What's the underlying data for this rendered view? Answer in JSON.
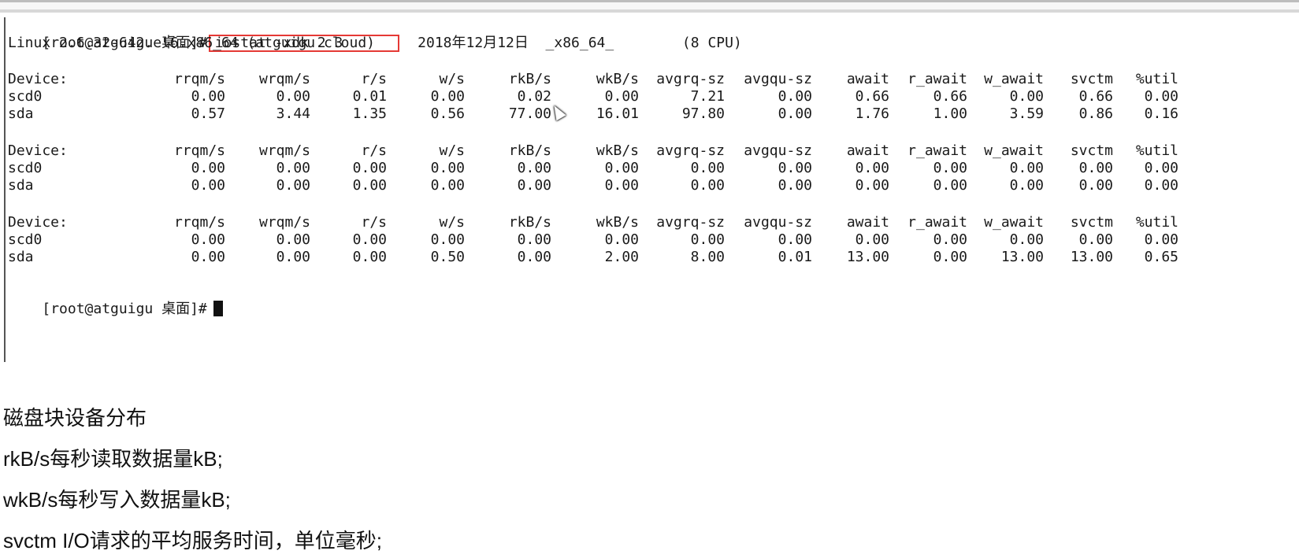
{
  "terminal": {
    "prompt": "[root@atguigu 桌面]#",
    "command": "iostat -xdk 2 3",
    "sysinfo": "Linux 2.6.32-642.el6.x86_64 (atguigu.cloud)     2018年12月12日  _x86_64_        (8 CPU)",
    "columns": [
      "Device:",
      "rrqm/s",
      "wrqm/s",
      "r/s",
      "w/s",
      "rkB/s",
      "wkB/s",
      "avgrq-sz",
      "avgqu-sz",
      "await",
      "r_await",
      "w_await",
      "svctm",
      "%util"
    ],
    "reports": [
      {
        "rows": [
          [
            "scd0",
            "0.00",
            "0.00",
            "0.01",
            "0.00",
            "0.02",
            "0.00",
            "7.21",
            "0.00",
            "0.66",
            "0.66",
            "0.00",
            "0.66",
            "0.00"
          ],
          [
            "sda",
            "0.57",
            "3.44",
            "1.35",
            "0.56",
            "77.00",
            "16.01",
            "97.80",
            "0.00",
            "1.76",
            "1.00",
            "3.59",
            "0.86",
            "0.16"
          ]
        ]
      },
      {
        "rows": [
          [
            "scd0",
            "0.00",
            "0.00",
            "0.00",
            "0.00",
            "0.00",
            "0.00",
            "0.00",
            "0.00",
            "0.00",
            "0.00",
            "0.00",
            "0.00",
            "0.00"
          ],
          [
            "sda",
            "0.00",
            "0.00",
            "0.00",
            "0.00",
            "0.00",
            "0.00",
            "0.00",
            "0.00",
            "0.00",
            "0.00",
            "0.00",
            "0.00",
            "0.00"
          ]
        ]
      },
      {
        "rows": [
          [
            "scd0",
            "0.00",
            "0.00",
            "0.00",
            "0.00",
            "0.00",
            "0.00",
            "0.00",
            "0.00",
            "0.00",
            "0.00",
            "0.00",
            "0.00",
            "0.00"
          ],
          [
            "sda",
            "0.00",
            "0.00",
            "0.00",
            "0.50",
            "0.00",
            "2.00",
            "8.00",
            "0.01",
            "13.00",
            "0.00",
            "13.00",
            "13.00",
            "0.65"
          ]
        ]
      }
    ],
    "final_prompt": "[root@atguigu 桌面]#"
  },
  "notes": {
    "line1": "磁盘块设备分布",
    "line2": "rkB/s每秒读取数据量kB;",
    "line3": "wkB/s每秒写入数据量kB;",
    "line4": "svctm I/O请求的平均服务时间，单位毫秒;"
  },
  "icons": {
    "cursor": "text-cursor-icon",
    "pointer": "mouse-pointer-icon"
  },
  "colors": {
    "highlight_border": "#e53935",
    "terminal_text": "#1a1a1a"
  }
}
